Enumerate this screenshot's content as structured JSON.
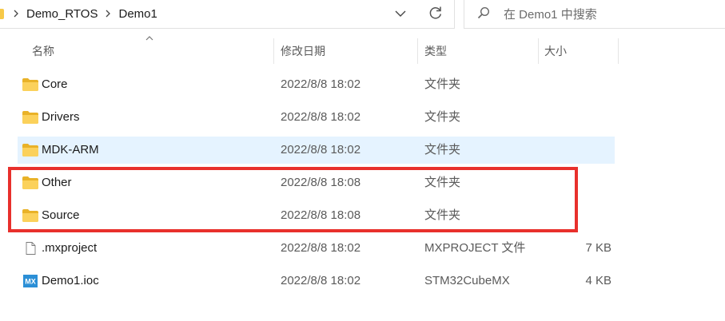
{
  "address_bar": {
    "crumbs": [
      "Demo_RTOS",
      "Demo1"
    ]
  },
  "search": {
    "placeholder": "在 Demo1 中搜索"
  },
  "columns": {
    "name": "名称",
    "date": "修改日期",
    "type": "类型",
    "size": "大小"
  },
  "files": [
    {
      "name": "Core",
      "date": "2022/8/8 18:02",
      "type": "文件夹",
      "size": "",
      "icon": "folder-icon"
    },
    {
      "name": "Drivers",
      "date": "2022/8/8 18:02",
      "type": "文件夹",
      "size": "",
      "icon": "folder-icon"
    },
    {
      "name": "MDK-ARM",
      "date": "2022/8/8 18:02",
      "type": "文件夹",
      "size": "",
      "icon": "folder-icon",
      "selected": true
    },
    {
      "name": "Other",
      "date": "2022/8/8 18:08",
      "type": "文件夹",
      "size": "",
      "icon": "folder-icon"
    },
    {
      "name": "Source",
      "date": "2022/8/8 18:08",
      "type": "文件夹",
      "size": "",
      "icon": "folder-icon"
    },
    {
      "name": ".mxproject",
      "date": "2022/8/8 18:02",
      "type": "MXPROJECT 文件",
      "size": "7 KB",
      "icon": "file-icon"
    },
    {
      "name": "Demo1.ioc",
      "date": "2022/8/8 18:02",
      "type": "STM32CubeMX",
      "size": "4 KB",
      "icon": "mx-icon",
      "icon_text": "MX"
    }
  ],
  "colors": {
    "highlight_box": "#e8302c",
    "selection": "#e5f3ff",
    "folder": "#f7c948",
    "mx_icon": "#2b8fd6"
  }
}
